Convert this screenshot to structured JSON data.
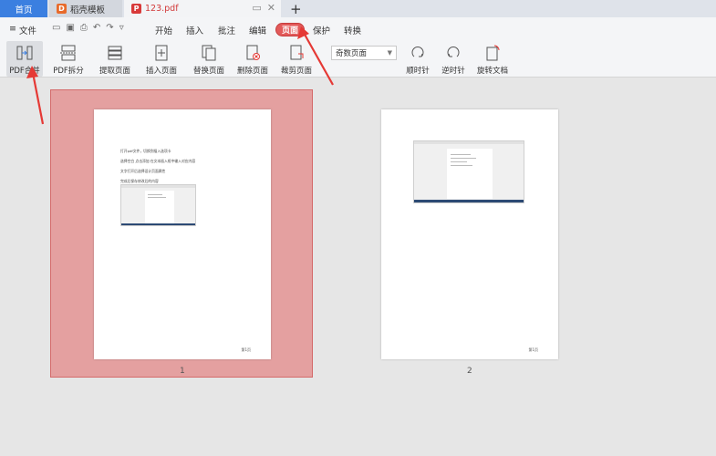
{
  "tabs": {
    "home": "首页",
    "template": "稻壳模板",
    "pdf": "123.pdf",
    "new_tab": "+"
  },
  "menu": {
    "file": "文件",
    "items": [
      "开始",
      "插入",
      "批注",
      "编辑",
      "页面",
      "保护",
      "转换"
    ],
    "active": "页面"
  },
  "ribbon": {
    "buttons": [
      "PDF合并",
      "PDF拆分",
      "提取页面",
      "插入页面",
      "替换页面",
      "删除页面",
      "裁剪页面",
      "顺时针",
      "逆时针",
      "旋转文档"
    ],
    "select_value": "奇数页面"
  },
  "pages": {
    "labels": [
      "1",
      "2"
    ],
    "footer": "第1页",
    "page1_lines": [
      "打开pdf文件，切换到插入选项卡",
      "选择空白   点击添加   在文本插入框中输入对应内容",
      "文字打开后选择设计页面属性",
      "完成后保存修改后的内容"
    ]
  },
  "colors": {
    "accent": "#3b7fe0",
    "highlight": "#e4a0a0",
    "arrow": "#e53935"
  }
}
